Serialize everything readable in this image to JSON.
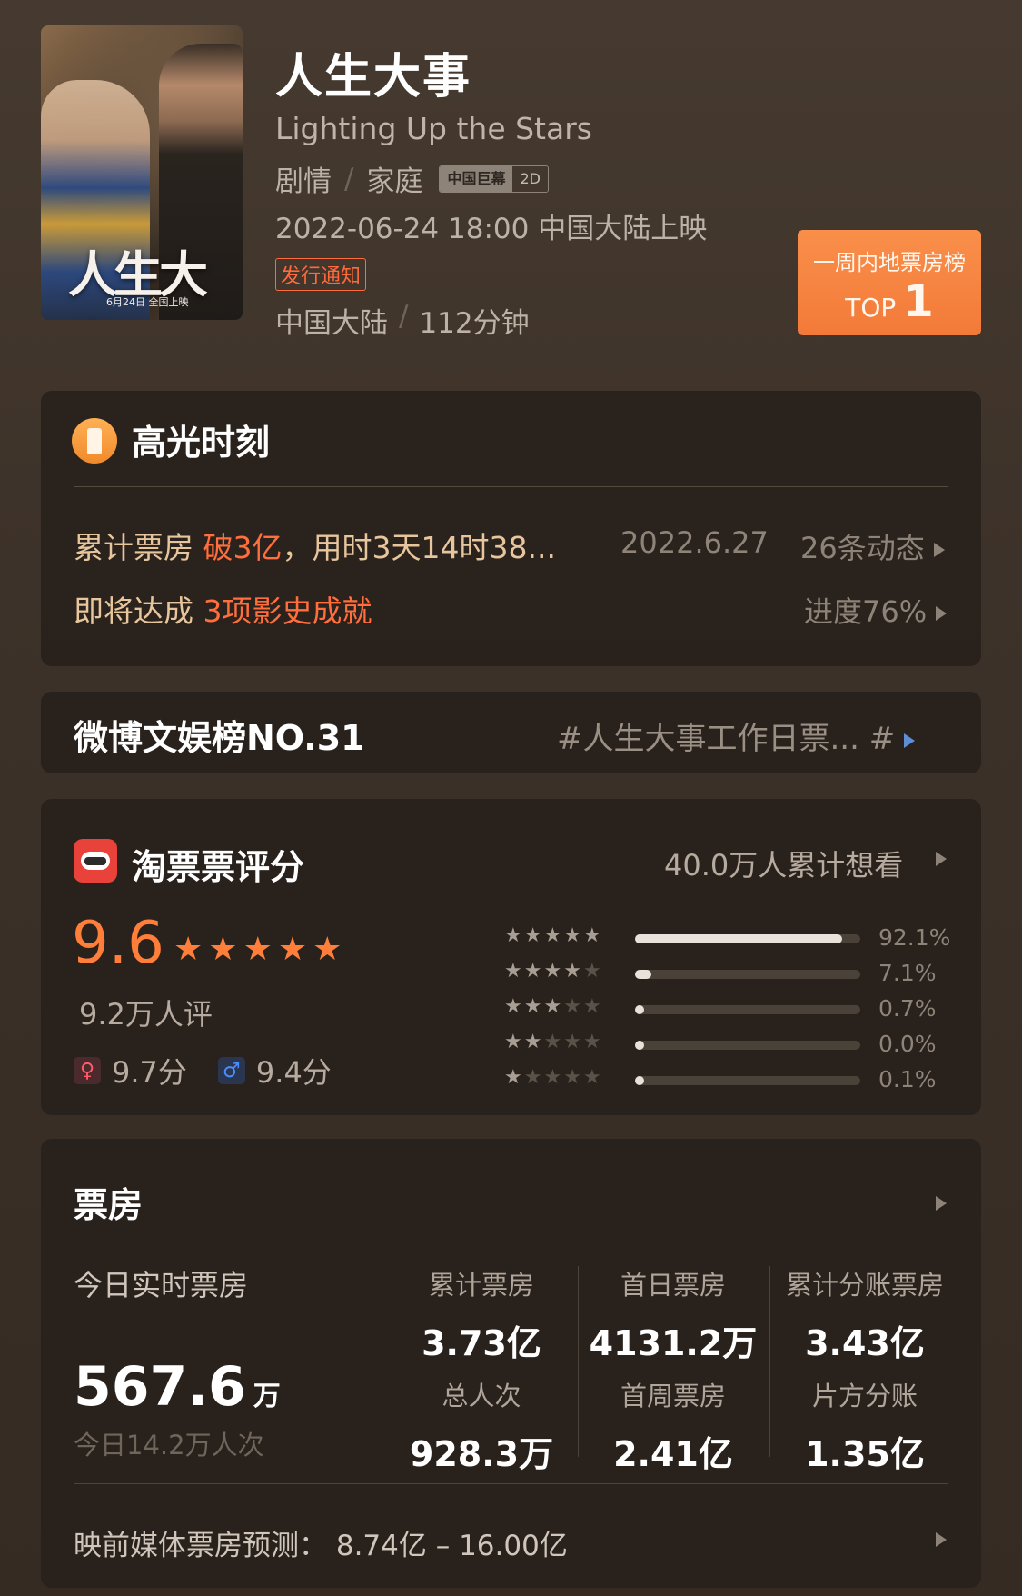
{
  "movie": {
    "poster_title": "人生大事",
    "poster_date": "6月24日 全国上映",
    "title": "人生大事",
    "english_title": "Lighting Up the Stars",
    "genres": [
      "剧情",
      "家庭"
    ],
    "format_badges": [
      "中国巨幕",
      "2D"
    ],
    "release": "2022-06-24 18:00 中国大陆上映",
    "notice_tag": "发行通知",
    "region": "中国大陆",
    "duration": "112分钟",
    "ranking_badge": {
      "line1": "一周内地票房榜",
      "prefix": "TOP",
      "rank": "1"
    }
  },
  "highlight": {
    "icon": "lighthouse-icon",
    "title": "高光时刻",
    "line1_prefix": "累计票房 ",
    "line1_hot": "破3亿",
    "line1_suffix": "，用时3天14时38...",
    "date": "2022.6.27",
    "dynamics": "26条动态",
    "line2_prefix": "即将达成 ",
    "line2_hot": "3项影史成就",
    "progress": "进度76%"
  },
  "weibo": {
    "title": "微博文娱榜NO.31",
    "topic": "#人生大事工作日票...  #"
  },
  "rating": {
    "icon": "taopiaopiao-icon",
    "title": "淘票票评分",
    "want_to_see": "40.0万人累计想看",
    "score": "9.6",
    "score_stars": 5,
    "rater_count": "9.2万人评",
    "female_score": "9.7分",
    "male_score": "9.4分",
    "distribution": [
      {
        "stars": 5,
        "percent": "92.1%",
        "fraction": 0.921
      },
      {
        "stars": 4,
        "percent": "7.1%",
        "fraction": 0.071
      },
      {
        "stars": 3,
        "percent": "0.7%",
        "fraction": 0.007
      },
      {
        "stars": 2,
        "percent": "0.0%",
        "fraction": 0.0
      },
      {
        "stars": 1,
        "percent": "0.1%",
        "fraction": 0.001
      }
    ]
  },
  "box_office": {
    "title": "票房",
    "today_label": "今日实时票房",
    "today_value": "567.6",
    "today_unit": "万",
    "today_viewers": "今日14.2万人次",
    "stats": [
      {
        "label": "累计票房",
        "value": "3.73亿"
      },
      {
        "label": "首日票房",
        "value": "4131.2万"
      },
      {
        "label": "累计分账票房",
        "value": "3.43亿"
      },
      {
        "label": "总人次",
        "value": "928.3万"
      },
      {
        "label": "首周票房",
        "value": "2.41亿"
      },
      {
        "label": "片方分账",
        "value": "1.35亿"
      }
    ],
    "forecast": "映前媒体票房预测：  8.74亿 – 16.00亿"
  },
  "colors": {
    "accent_orange": "#ff7e3a",
    "hot_red": "#ff6e3c",
    "gold_text": "#e7c59d",
    "badge_orange": "#f37a39"
  }
}
